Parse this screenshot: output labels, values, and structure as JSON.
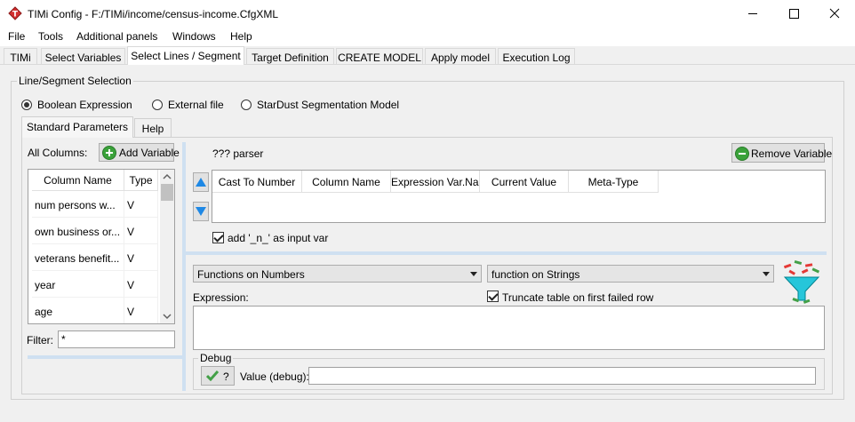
{
  "window": {
    "title": "TIMi Config - F:/TIMi/income/census-income.CfgXML"
  },
  "menu": [
    "File",
    "Tools",
    "Additional panels",
    "Windows",
    "Help"
  ],
  "tabs": [
    "TIMi",
    "Select Variables",
    "Select Lines / Segment",
    "Target Definition",
    "CREATE MODEL",
    "Apply model",
    "Execution Log"
  ],
  "active_tab": "Select Lines / Segment",
  "group": {
    "title": "Line/Segment Selection",
    "radios": [
      {
        "label": "Boolean Expression",
        "selected": true
      },
      {
        "label": "External file",
        "selected": false
      },
      {
        "label": "StarDust Segmentation Model",
        "selected": false
      }
    ]
  },
  "subtabs": [
    "Standard Parameters",
    "Help"
  ],
  "left": {
    "all_columns_label": "All Columns:",
    "add_variable_label": "Add Variable",
    "headers": [
      "Column Name",
      "Type"
    ],
    "rows": [
      {
        "name": "num persons w...",
        "type": "V"
      },
      {
        "name": "own business or...",
        "type": "V"
      },
      {
        "name": "veterans benefit...",
        "type": "V"
      },
      {
        "name": "year",
        "type": "V"
      },
      {
        "name": "age",
        "type": "V"
      }
    ],
    "filter_label": "Filter:",
    "filter_value": "*"
  },
  "right": {
    "parser_label": "??? parser",
    "remove_variable_label": "Remove Variable",
    "headers": [
      "Cast To Number",
      "Column Name",
      "Expression Var.Name",
      "Current Value",
      "Meta-Type"
    ],
    "add_n_label": "add '_n_' as input var",
    "add_n_checked": true,
    "functions_numbers": "Functions on Numbers",
    "functions_strings": "function on Strings",
    "expression_label": "Expression:",
    "truncate_label": "Truncate table on first failed row",
    "truncate_checked": true,
    "debug_title": "Debug",
    "debug_button_label": "?",
    "value_debug_label": "Value (debug):"
  },
  "colors": {
    "accent_green": "#3aa23a",
    "arrow_blue": "#1e88e5",
    "splitter": "#cfe0f1",
    "app_icon_red": "#d32f2f"
  }
}
